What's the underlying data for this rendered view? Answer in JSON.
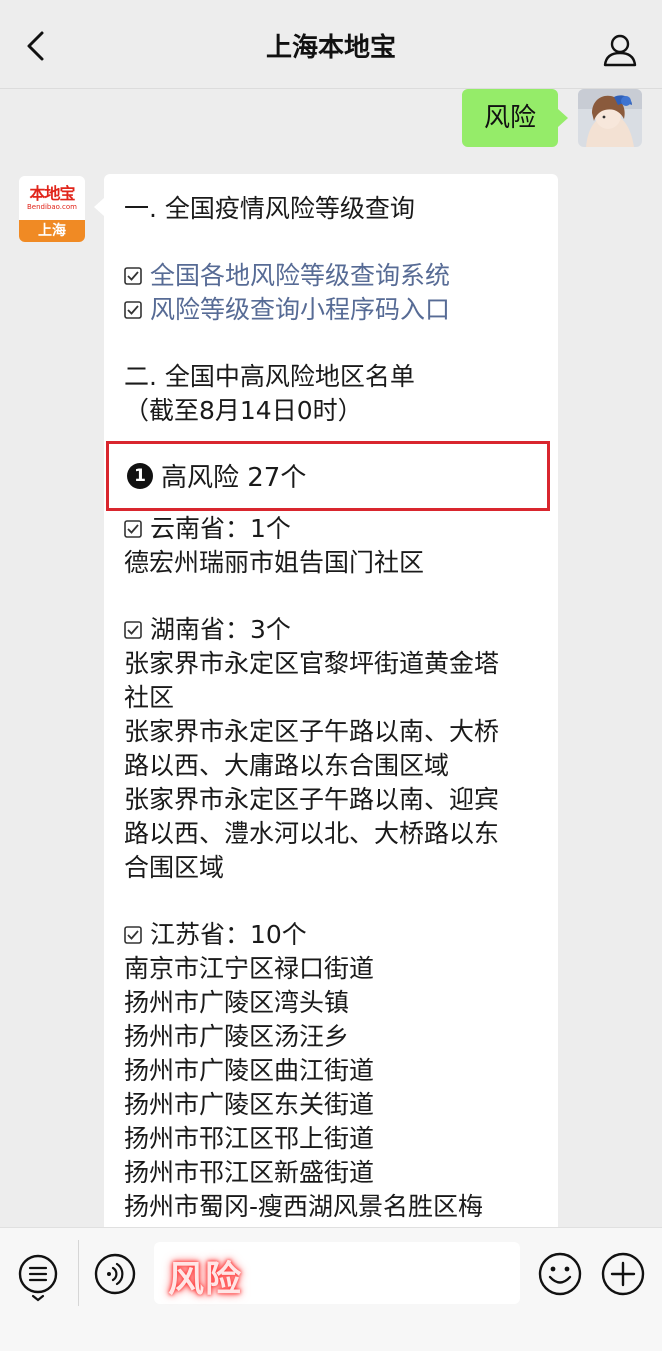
{
  "nav": {
    "title": "上海本地宝"
  },
  "user_message": {
    "text": "风险"
  },
  "bot": {
    "avatar": {
      "logo_main": "本地宝",
      "logo_sub": "Bendibao.com",
      "logo_city": "上海"
    },
    "section1_title": "一. 全国疫情风险等级查询",
    "links": [
      "全国各地风险等级查询系统",
      "风险等级查询小程序码入口"
    ],
    "section2_title": "二. 全国中高风险地区名单",
    "section2_note": "（截至8月14日0时）",
    "high_risk": {
      "badge": "1",
      "label": "高风险 27个"
    },
    "provinces": [
      {
        "header": "云南省：1个",
        "lines": [
          "德宏州瑞丽市姐告国门社区"
        ]
      },
      {
        "header": "湖南省：3个",
        "lines": [
          "张家界市永定区官黎坪街道黄金塔",
          "社区",
          "张家界市永定区子午路以南、大桥",
          "路以西、大庸路以东合围区域",
          "张家界市永定区子午路以南、迎宾",
          "路以西、澧水河以北、大桥路以东",
          "合围区域"
        ]
      },
      {
        "header": "江苏省：10个",
        "lines": [
          "南京市江宁区禄口街道",
          "扬州市广陵区湾头镇",
          "扬州市广陵区汤汪乡",
          "扬州市广陵区曲江街道",
          "扬州市广陵区东关街道",
          "扬州市邗江区邗上街道",
          "扬州市邗江区新盛街道",
          "扬州市蜀冈-瘦西湖风景名胜区梅"
        ]
      }
    ]
  },
  "input_bar": {
    "text": "风险"
  },
  "colors": {
    "user_bubble": "#95ec69",
    "link": "#576b95",
    "highlight_border": "#d9262e",
    "brand_red": "#e1251b",
    "brand_orange": "#f08a24"
  }
}
